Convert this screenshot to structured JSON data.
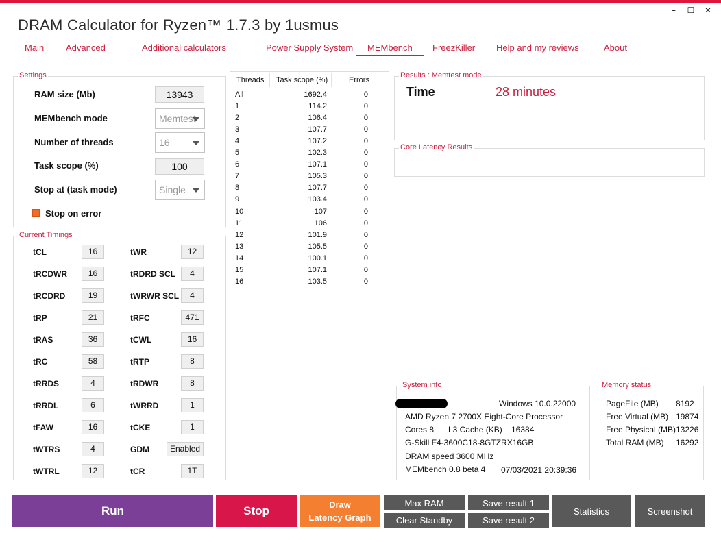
{
  "window": {
    "title": "DRAM Calculator for Ryzen™ 1.7.3 by 1usmus",
    "controls": {
      "minimize": "–",
      "maximize": "☐",
      "close": "✕"
    }
  },
  "tabs": [
    "Main",
    "Advanced",
    "Additional calculators",
    "Power Supply System",
    "MEMbench",
    "FreezKiller",
    "Help and my reviews",
    "About"
  ],
  "active_tab": "MEMbench",
  "colors": {
    "accent": "#e0153c",
    "tab_text": "#c9213f",
    "run": "#7b3f98",
    "stop": "#d9164a",
    "latency": "#f57f31",
    "gray": "#595959"
  },
  "settings": {
    "title": "Settings",
    "ram_size_label": "RAM size (Mb)",
    "ram_size_value": "13943",
    "mode_label": "MEMbench mode",
    "mode_value": "Memtest",
    "threads_label": "Number of threads",
    "threads_value": "16",
    "task_scope_label": "Task scope (%)",
    "task_scope_value": "100",
    "stop_at_label": "Stop at (task mode)",
    "stop_at_value": "Single",
    "stop_on_error_label": "Stop on error"
  },
  "timings": {
    "title": "Current Timings",
    "left": [
      {
        "label": "tCL",
        "value": "16"
      },
      {
        "label": "tRCDWR",
        "value": "16"
      },
      {
        "label": "tRCDRD",
        "value": "19"
      },
      {
        "label": "tRP",
        "value": "21"
      },
      {
        "label": "tRAS",
        "value": "36"
      },
      {
        "label": "tRC",
        "value": "58"
      },
      {
        "label": "tRRDS",
        "value": "4"
      },
      {
        "label": "tRRDL",
        "value": "6"
      },
      {
        "label": "tFAW",
        "value": "16"
      },
      {
        "label": "tWTRS",
        "value": "4"
      },
      {
        "label": "tWTRL",
        "value": "12"
      }
    ],
    "right": [
      {
        "label": "tWR",
        "value": "12"
      },
      {
        "label": "tRDRD SCL",
        "value": "4"
      },
      {
        "label": "tWRWR SCL",
        "value": "4"
      },
      {
        "label": "tRFC",
        "value": "471"
      },
      {
        "label": "tCWL",
        "value": "16"
      },
      {
        "label": "tRTP",
        "value": "8"
      },
      {
        "label": "tRDWR",
        "value": "8"
      },
      {
        "label": "tWRRD",
        "value": "1"
      },
      {
        "label": "tCKE",
        "value": "1"
      },
      {
        "label": "GDM",
        "value": "Enabled"
      },
      {
        "label": "tCR",
        "value": "1T"
      }
    ]
  },
  "thread_table": {
    "headers": {
      "threads": "Threads",
      "scope": "Task scope (%)",
      "errors": "Errors"
    },
    "rows": [
      {
        "thread": "All",
        "scope": "1692.4",
        "errors": "0"
      },
      {
        "thread": "1",
        "scope": "114.2",
        "errors": "0"
      },
      {
        "thread": "2",
        "scope": "106.4",
        "errors": "0"
      },
      {
        "thread": "3",
        "scope": "107.7",
        "errors": "0"
      },
      {
        "thread": "4",
        "scope": "107.2",
        "errors": "0"
      },
      {
        "thread": "5",
        "scope": "102.3",
        "errors": "0"
      },
      {
        "thread": "6",
        "scope": "107.1",
        "errors": "0"
      },
      {
        "thread": "7",
        "scope": "105.3",
        "errors": "0"
      },
      {
        "thread": "8",
        "scope": "107.7",
        "errors": "0"
      },
      {
        "thread": "9",
        "scope": "103.4",
        "errors": "0"
      },
      {
        "thread": "10",
        "scope": "107",
        "errors": "0"
      },
      {
        "thread": "11",
        "scope": "106",
        "errors": "0"
      },
      {
        "thread": "12",
        "scope": "101.9",
        "errors": "0"
      },
      {
        "thread": "13",
        "scope": "105.5",
        "errors": "0"
      },
      {
        "thread": "14",
        "scope": "100.1",
        "errors": "0"
      },
      {
        "thread": "15",
        "scope": "107.1",
        "errors": "0"
      },
      {
        "thread": "16",
        "scope": "103.5",
        "errors": "0"
      }
    ]
  },
  "results": {
    "title": "Results : Memtest mode",
    "time_label": "Time",
    "time_value": "28 minutes"
  },
  "core_latency": {
    "title": "Core Latency Results"
  },
  "system_info": {
    "title": "System info",
    "os": "Windows 10.0.22000",
    "cpu": "AMD Ryzen 7 2700X Eight-Core Processor",
    "cores": "Cores 8",
    "l3_label": "L3 Cache (KB)",
    "l3_value": "16384",
    "ram": "G-Skill F4-3600C18-8GTZRX16GB",
    "dram_speed": "DRAM speed 3600 MHz",
    "bench_version": "MEMbench 0.8 beta 4",
    "datetime": "07/03/2021 20:39:36"
  },
  "memory_status": {
    "title": "Memory status",
    "items": [
      {
        "label": "PageFile (MB)",
        "value": "8192"
      },
      {
        "label": "Free Virtual (MB)",
        "value": "19874"
      },
      {
        "label": "Free Physical (MB)",
        "value": "13226"
      },
      {
        "label": "Total RAM (MB)",
        "value": "16292"
      }
    ]
  },
  "buttons": {
    "run": "Run",
    "stop": "Stop",
    "latency_line1": "Draw",
    "latency_line2": "Latency Graph",
    "max_ram": "Max RAM",
    "clear_standby": "Clear Standby",
    "save1": "Save result 1",
    "save2": "Save result 2",
    "statistics": "Statistics",
    "screenshot": "Screenshot"
  }
}
